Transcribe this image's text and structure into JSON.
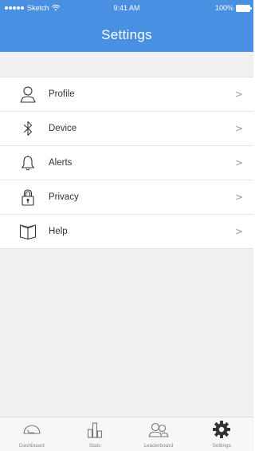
{
  "status_bar": {
    "carrier": "Sketch",
    "time": "9:41 AM",
    "battery": "100%"
  },
  "header": {
    "title": "Settings"
  },
  "menu": {
    "items": [
      {
        "label": "Profile",
        "icon": "person-icon"
      },
      {
        "label": "Device",
        "icon": "bluetooth-icon"
      },
      {
        "label": "Alerts",
        "icon": "bell-icon"
      },
      {
        "label": "Privacy",
        "icon": "padlock-icon"
      },
      {
        "label": "Help",
        "icon": "book-icon"
      }
    ],
    "chevron": ">"
  },
  "tabbar": {
    "tabs": [
      {
        "label": "Dashboard",
        "icon": "gauge-icon"
      },
      {
        "label": "Stats",
        "icon": "bar-chart-icon"
      },
      {
        "label": "Leaderboard",
        "icon": "people-icon"
      },
      {
        "label": "Settings",
        "icon": "gear-icon"
      }
    ]
  },
  "colors": {
    "accent": "#4a90e2",
    "background": "#f0f0f0",
    "row_background": "#ffffff",
    "text": "#333333",
    "muted": "#8a8a8a"
  }
}
